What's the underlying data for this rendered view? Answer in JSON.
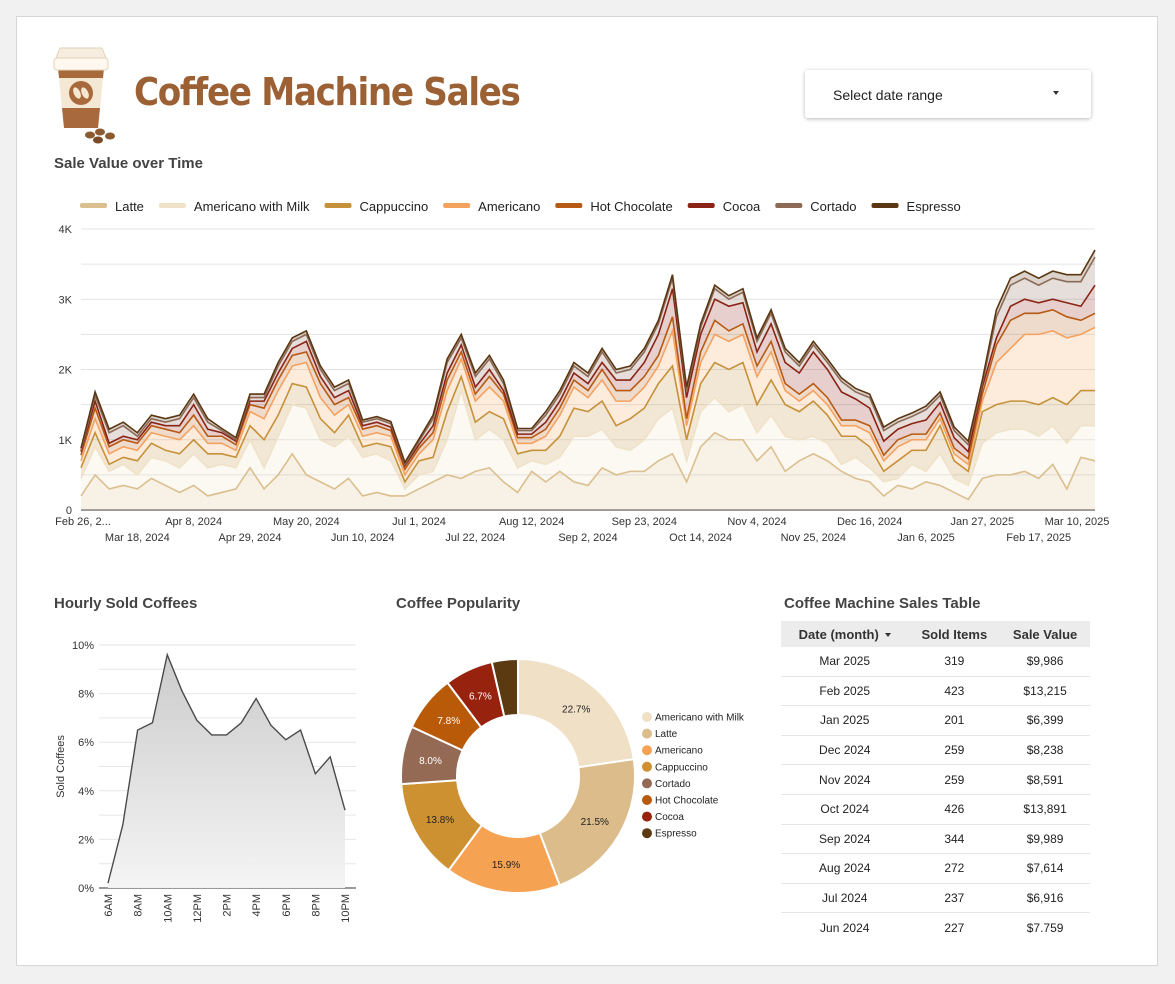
{
  "header": {
    "title": "Coffee Machine Sales",
    "date_select_label": "Select date range"
  },
  "sections": {
    "sales_over_time": "Sale Value over Time",
    "hourly": "Hourly Sold Coffees",
    "popularity": "Coffee Popularity",
    "table": "Coffee Machine Sales Table"
  },
  "chart_data": [
    {
      "type": "area",
      "title": "Sale Value over Time",
      "stacked": true,
      "ylim": [
        0,
        4000
      ],
      "y_ticks": [
        "0",
        "1K",
        "2K",
        "3K",
        "4K"
      ],
      "x_tick_labels_row1": [
        "Feb 26, 2...",
        "Apr 8, 2024",
        "May 20, 2024",
        "Jul 1, 2024",
        "Aug 12, 2024",
        "Sep 23, 2024",
        "Nov 4, 2024",
        "Dec 16, 2024",
        "Jan 27, 2025",
        "Mar 10, 2025"
      ],
      "x_tick_labels_row2": [
        "Mar 18, 2024",
        "Apr 29, 2024",
        "Jun 10, 2024",
        "Jul 22, 2024",
        "Sep 2, 2024",
        "Oct 14, 2024",
        "Nov 25, 2024",
        "Jan 6, 2025",
        "Feb 17, 2025"
      ],
      "legend": "top",
      "series": [
        {
          "name": "Latte",
          "color": "#dbbf8e",
          "values": [
            200,
            500,
            300,
            350,
            300,
            450,
            350,
            250,
            350,
            200,
            250,
            300,
            600,
            300,
            500,
            800,
            500,
            400,
            300,
            450,
            200,
            250,
            200,
            200,
            300,
            400,
            500,
            450,
            550,
            600,
            400,
            250,
            550,
            400,
            550,
            400,
            350,
            600,
            500,
            550,
            550,
            700,
            800,
            400,
            900,
            1100,
            1000,
            1000,
            700,
            900,
            550,
            700,
            800,
            700,
            550,
            450,
            400,
            200,
            350,
            300,
            400,
            350,
            250,
            150,
            450,
            500,
            500,
            550,
            450,
            650,
            300,
            750,
            700
          ]
        },
        {
          "name": "Americano with Milk",
          "color": "#f0e2c8",
          "values": [
            250,
            400,
            250,
            300,
            200,
            300,
            350,
            350,
            450,
            400,
            400,
            300,
            400,
            300,
            550,
            700,
            950,
            600,
            600,
            600,
            550,
            550,
            500,
            100,
            200,
            150,
            500,
            1250,
            450,
            550,
            600,
            350,
            150,
            250,
            200,
            650,
            700,
            550,
            400,
            300,
            450,
            600,
            650,
            300,
            500,
            500,
            400,
            500,
            400,
            450,
            500,
            300,
            250,
            250,
            100,
            300,
            200,
            200,
            100,
            350,
            150,
            450,
            200,
            200,
            500,
            600,
            650,
            600,
            600,
            550,
            650,
            450,
            500
          ]
        },
        {
          "name": "Cappuccino",
          "color": "#c5913a",
          "values": [
            150,
            200,
            100,
            100,
            200,
            200,
            150,
            200,
            200,
            200,
            150,
            150,
            200,
            400,
            300,
            300,
            300,
            300,
            200,
            300,
            150,
            150,
            200,
            100,
            200,
            200,
            400,
            200,
            250,
            250,
            300,
            200,
            150,
            200,
            300,
            400,
            350,
            400,
            300,
            450,
            450,
            500,
            600,
            300,
            400,
            500,
            600,
            600,
            400,
            500,
            450,
            400,
            500,
            400,
            400,
            300,
            300,
            150,
            250,
            200,
            300,
            400,
            250,
            200,
            450,
            400,
            400,
            400,
            450,
            400,
            550,
            500,
            500
          ]
        },
        {
          "name": "Americano",
          "color": "#f4a260",
          "values": [
            100,
            200,
            150,
            150,
            150,
            150,
            200,
            200,
            200,
            150,
            150,
            100,
            200,
            300,
            350,
            250,
            350,
            300,
            250,
            150,
            150,
            150,
            150,
            100,
            100,
            250,
            300,
            250,
            300,
            350,
            250,
            150,
            100,
            200,
            300,
            300,
            200,
            300,
            350,
            250,
            300,
            250,
            500,
            200,
            300,
            400,
            400,
            400,
            400,
            400,
            200,
            150,
            150,
            150,
            150,
            150,
            200,
            150,
            200,
            150,
            150,
            100,
            100,
            100,
            150,
            600,
            750,
            950,
            1000,
            950,
            950,
            800,
            900
          ]
        },
        {
          "name": "Hot Chocolate",
          "color": "#b65a14",
          "values": [
            80,
            150,
            100,
            100,
            100,
            100,
            100,
            100,
            150,
            100,
            100,
            80,
            100,
            150,
            150,
            150,
            150,
            200,
            150,
            100,
            100,
            100,
            80,
            80,
            80,
            100,
            150,
            100,
            100,
            150,
            100,
            80,
            80,
            100,
            100,
            100,
            100,
            150,
            150,
            150,
            150,
            150,
            200,
            100,
            150,
            200,
            150,
            150,
            150,
            150,
            100,
            100,
            100,
            100,
            80,
            80,
            100,
            80,
            100,
            80,
            80,
            80,
            80,
            80,
            100,
            250,
            400,
            300,
            300,
            300,
            300,
            200,
            200
          ]
        },
        {
          "name": "Cocoa",
          "color": "#8b2416",
          "values": [
            50,
            100,
            50,
            50,
            50,
            50,
            50,
            100,
            150,
            100,
            50,
            50,
            50,
            100,
            100,
            100,
            150,
            100,
            100,
            100,
            50,
            50,
            50,
            50,
            50,
            100,
            100,
            100,
            100,
            100,
            50,
            50,
            50,
            100,
            100,
            100,
            100,
            100,
            150,
            150,
            200,
            300,
            400,
            300,
            250,
            300,
            350,
            300,
            200,
            250,
            300,
            300,
            450,
            400,
            400,
            300,
            250,
            200,
            150,
            150,
            200,
            150,
            150,
            100,
            100,
            100,
            200,
            200,
            150,
            150,
            200,
            200,
            400
          ]
        },
        {
          "name": "Cortado",
          "color": "#8c6a56",
          "values": [
            20,
            80,
            150,
            150,
            50,
            50,
            50,
            100,
            100,
            100,
            30,
            20,
            50,
            50,
            100,
            100,
            100,
            100,
            100,
            100,
            50,
            50,
            50,
            20,
            50,
            100,
            150,
            100,
            150,
            150,
            100,
            50,
            50,
            100,
            100,
            100,
            100,
            150,
            100,
            150,
            150,
            150,
            150,
            100,
            100,
            150,
            100,
            150,
            150,
            150,
            150,
            100,
            100,
            100,
            150,
            100,
            150,
            150,
            100,
            100,
            150,
            100,
            100,
            100,
            50,
            300,
            300,
            300,
            250,
            300,
            300,
            350,
            400
          ]
        },
        {
          "name": "Espresso",
          "color": "#5a3712",
          "values": [
            30,
            50,
            50,
            50,
            50,
            50,
            50,
            50,
            50,
            50,
            30,
            30,
            50,
            50,
            50,
            50,
            50,
            50,
            50,
            50,
            30,
            30,
            30,
            30,
            30,
            50,
            50,
            50,
            50,
            50,
            50,
            30,
            30,
            50,
            50,
            50,
            50,
            50,
            50,
            50,
            50,
            50,
            50,
            50,
            50,
            50,
            50,
            50,
            50,
            50,
            50,
            50,
            50,
            50,
            50,
            50,
            50,
            50,
            50,
            50,
            50,
            50,
            50,
            50,
            50,
            100,
            100,
            100,
            100,
            100,
            100,
            100,
            100
          ]
        }
      ]
    },
    {
      "type": "area",
      "title": "Hourly Sold Coffees",
      "ylabel": "Sold Coffees",
      "ylim": [
        0,
        10
      ],
      "y_ticks": [
        "0%",
        "2%",
        "4%",
        "6%",
        "8%",
        "10%"
      ],
      "x_tick_labels": [
        "6AM",
        "8AM",
        "10AM",
        "12PM",
        "2PM",
        "4PM",
        "6PM",
        "8PM",
        "10PM"
      ],
      "x": [
        6,
        7,
        8,
        9,
        10,
        11,
        12,
        13,
        14,
        15,
        16,
        17,
        18,
        19,
        20,
        21,
        22
      ],
      "values": [
        0.2,
        2.6,
        6.5,
        6.8,
        9.6,
        8.1,
        6.9,
        6.3,
        6.3,
        6.8,
        7.8,
        6.7,
        6.1,
        6.5,
        4.7,
        5.4,
        3.2
      ]
    },
    {
      "type": "pie",
      "title": "Coffee Popularity",
      "donut": true,
      "legend": "right",
      "slices": [
        {
          "label": "Americano with Milk",
          "value": 22.7,
          "pct_label": "22.7%",
          "color": "#f0e0c6"
        },
        {
          "label": "Latte",
          "value": 21.5,
          "pct_label": "21.5%",
          "color": "#dbbc8a"
        },
        {
          "label": "Americano",
          "value": 15.9,
          "pct_label": "15.9%",
          "color": "#f6a253"
        },
        {
          "label": "Cappuccino",
          "value": 13.8,
          "pct_label": "13.8%",
          "color": "#ce9132"
        },
        {
          "label": "Cortado",
          "value": 8.0,
          "pct_label": "8.0%",
          "color": "#946a55"
        },
        {
          "label": "Hot Chocolate",
          "value": 7.8,
          "pct_label": "7.8%",
          "color": "#b85a08"
        },
        {
          "label": "Cocoa",
          "value": 6.7,
          "pct_label": "6.7%",
          "color": "#97220e"
        },
        {
          "label": "Espresso",
          "value": 3.6,
          "pct_label": "",
          "color": "#5b3a11"
        }
      ]
    },
    {
      "type": "table",
      "title": "Coffee Machine Sales Table",
      "columns": [
        "Date (month)",
        "Sold Items",
        "Sale Value"
      ],
      "rows": [
        [
          "Mar 2025",
          "319",
          "$9,986"
        ],
        [
          "Feb 2025",
          "423",
          "$13,215"
        ],
        [
          "Jan 2025",
          "201",
          "$6,399"
        ],
        [
          "Dec 2024",
          "259",
          "$8,238"
        ],
        [
          "Nov 2024",
          "259",
          "$8,591"
        ],
        [
          "Oct 2024",
          "426",
          "$13,891"
        ],
        [
          "Sep 2024",
          "344",
          "$9,989"
        ],
        [
          "Aug 2024",
          "272",
          "$7,614"
        ],
        [
          "Jul 2024",
          "237",
          "$6,916"
        ],
        [
          "Jun 2024",
          "227",
          "$7.759"
        ]
      ]
    }
  ]
}
